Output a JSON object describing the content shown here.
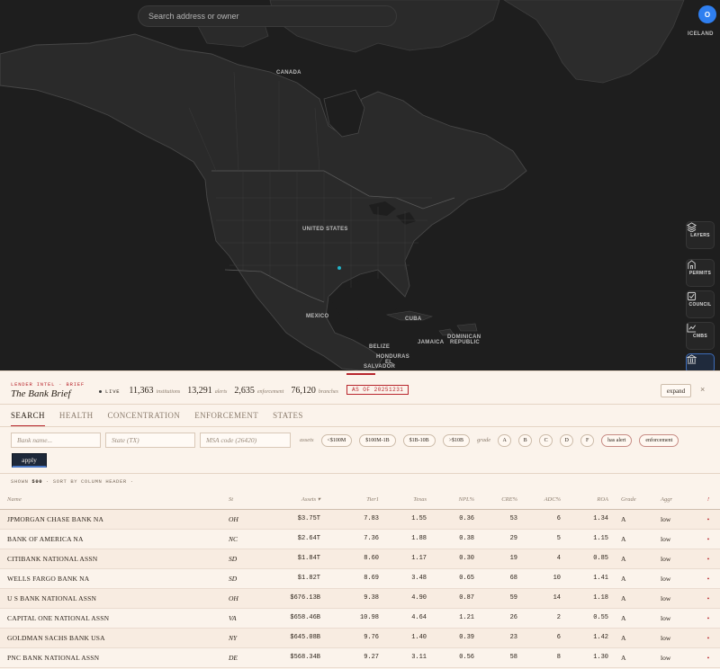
{
  "map": {
    "search_placeholder": "Search address or owner",
    "labels": {
      "canada": "CANADA",
      "iceland": "ICELAND",
      "united_states": "UNITED STATES",
      "mexico": "MEXICO",
      "cuba": "CUBA",
      "jamaica": "JAMAICA",
      "belize": "BELIZE",
      "honduras": "HONDURAS",
      "el_salvador_1": "EL",
      "el_salvador_2": "SALVADOR",
      "dominican_1": "DOMINICAN",
      "dominican_2": "REPUBLIC"
    },
    "marker_color": "#22b4c8"
  },
  "user": {
    "initial": "O"
  },
  "side_buttons": [
    {
      "label": "LAYERS",
      "icon": "layers-icon"
    },
    {
      "label": "PERMITS",
      "icon": "building-icon"
    },
    {
      "label": "COUNCIL",
      "icon": "checklist-icon"
    },
    {
      "label": "CMBS",
      "icon": "chart-line-icon"
    },
    {
      "label": "",
      "icon": "bank-icon"
    }
  ],
  "panel": {
    "kicker": "LENDER INTEL · BRIEF",
    "title": "The Bank Brief",
    "live": "LIVE",
    "stats": [
      {
        "value": "11,363",
        "unit": "institutions"
      },
      {
        "value": "13,291",
        "unit": "alerts"
      },
      {
        "value": "2,635",
        "unit": "enforcement"
      },
      {
        "value": "76,120",
        "unit": "branches"
      }
    ],
    "as_of": "AS OF 20251231",
    "expand": "expand",
    "close": "×",
    "tabs": [
      "SEARCH",
      "HEALTH",
      "CONCENTRATION",
      "ENFORCEMENT",
      "STATES"
    ],
    "filters": {
      "bank_placeholder": "Bank name...",
      "state_placeholder": "State (TX)",
      "msa_placeholder": "MSA code (26420)",
      "assets_label": "assets",
      "asset_chips": [
        "<$100M",
        "$100M-1B",
        "$1B-10B",
        ">$10B"
      ],
      "grade_label": "grade",
      "grade_chips": [
        "A",
        "B",
        "C",
        "D",
        "F"
      ],
      "toggles": [
        "has alert",
        "enforcement"
      ]
    },
    "apply": "apply",
    "shown_prefix": "SHOWN",
    "shown_count": "500",
    "shown_suffix": "· SORT BY COLUMN HEADER ·",
    "columns": [
      "Name",
      "St",
      "Assets ▾",
      "Tier1",
      "Texas",
      "NPL%",
      "CRE%",
      "ADC%",
      "ROA",
      "Grade",
      "Aggr",
      "!"
    ],
    "rows": [
      [
        "JPMORGAN CHASE BANK NA",
        "OH",
        "$3.75T",
        "7.83",
        "1.55",
        "0.36",
        "53",
        "6",
        "1.34",
        "A",
        "low",
        "•"
      ],
      [
        "BANK OF AMERICA NA",
        "NC",
        "$2.64T",
        "7.36",
        "1.88",
        "0.38",
        "29",
        "5",
        "1.15",
        "A",
        "low",
        "•"
      ],
      [
        "CITIBANK NATIONAL ASSN",
        "SD",
        "$1.84T",
        "8.60",
        "1.17",
        "0.30",
        "19",
        "4",
        "0.85",
        "A",
        "low",
        "•"
      ],
      [
        "WELLS FARGO BANK NA",
        "SD",
        "$1.82T",
        "8.69",
        "3.48",
        "0.65",
        "68",
        "10",
        "1.41",
        "A",
        "low",
        "•"
      ],
      [
        "U S BANK NATIONAL ASSN",
        "OH",
        "$676.13B",
        "9.38",
        "4.90",
        "0.87",
        "59",
        "14",
        "1.18",
        "A",
        "low",
        "•"
      ],
      [
        "CAPITAL ONE NATIONAL ASSN",
        "VA",
        "$658.46B",
        "10.98",
        "4.64",
        "1.21",
        "26",
        "2",
        "0.55",
        "A",
        "low",
        "•"
      ],
      [
        "GOLDMAN SACHS BANK USA",
        "NY",
        "$645.08B",
        "9.76",
        "1.40",
        "0.39",
        "23",
        "6",
        "1.42",
        "A",
        "low",
        "•"
      ],
      [
        "PNC BANK NATIONAL ASSN",
        "DE",
        "$568.34B",
        "9.27",
        "3.11",
        "0.56",
        "58",
        "8",
        "1.30",
        "A",
        "low",
        "•"
      ]
    ]
  }
}
